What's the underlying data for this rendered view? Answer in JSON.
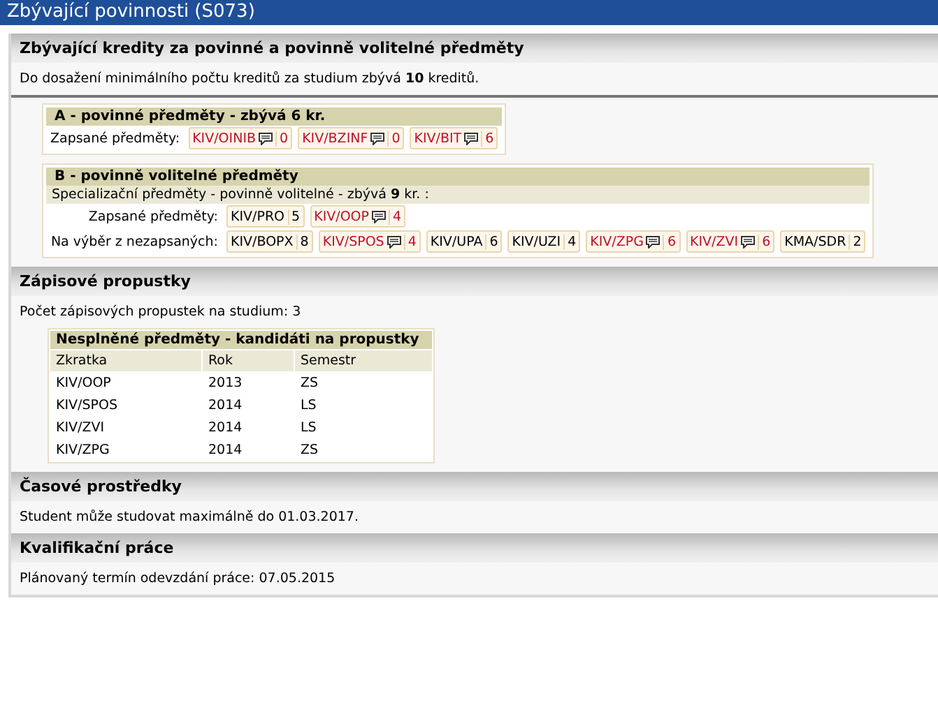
{
  "window": {
    "title": "Zbývající povinnosti (S073)"
  },
  "credits": {
    "title": "Zbývající kredity za povinné a povinně volitelné předměty",
    "summary": "Do dosažení minimálního počtu kreditů za studium zbývá **10** kreditů.",
    "groups": [
      {
        "title": "A - povinné předměty - zbývá 6 kr.",
        "rows": [
          {
            "label": "Zapsané předměty:",
            "courses": [
              {
                "code": "KIV/OINIB",
                "credits": "0",
                "flagged": true
              },
              {
                "code": "KIV/BZINF",
                "credits": "0",
                "flagged": true
              },
              {
                "code": "KIV/BIT",
                "credits": "6",
                "flagged": true
              }
            ]
          }
        ]
      },
      {
        "title": "B - povinně volitelné předměty",
        "subtitle": "Specializační předměty - povinně volitelné - zbývá **9** kr. :",
        "rows": [
          {
            "label": "Zapsané předměty:",
            "courses": [
              {
                "code": "KIV/PRO",
                "credits": "5",
                "flagged": false
              },
              {
                "code": "KIV/OOP",
                "credits": "4",
                "flagged": true
              }
            ]
          },
          {
            "label": "Na výběr z nezapsaných:",
            "courses": [
              {
                "code": "KIV/BOPX",
                "credits": "8",
                "flagged": false
              },
              {
                "code": "KIV/SPOS",
                "credits": "4",
                "flagged": true
              },
              {
                "code": "KIV/UPA",
                "credits": "6",
                "flagged": false
              },
              {
                "code": "KIV/UZI",
                "credits": "4",
                "flagged": false
              },
              {
                "code": "KIV/ZPG",
                "credits": "6",
                "flagged": true
              },
              {
                "code": "KIV/ZVI",
                "credits": "6",
                "flagged": true
              },
              {
                "code": "KMA/SDR",
                "credits": "2",
                "flagged": false
              }
            ]
          }
        ]
      }
    ]
  },
  "passes": {
    "title": "Zápisové propustky",
    "summary": "Počet zápisových propustek na studium: 3",
    "table": {
      "title": "Nesplněné předměty - kandidáti na propustky",
      "columns": [
        "Zkratka",
        "Rok",
        "Semestr"
      ],
      "rows": [
        [
          "KIV/OOP",
          "2013",
          "ZS"
        ],
        [
          "KIV/SPOS",
          "2014",
          "LS"
        ],
        [
          "KIV/ZVI",
          "2014",
          "LS"
        ],
        [
          "KIV/ZPG",
          "2014",
          "ZS"
        ]
      ]
    }
  },
  "time": {
    "title": "Časové prostředky",
    "text": "Student může studovat maximálně do 01.03.2017."
  },
  "thesis": {
    "title": "Kvalifikační práce",
    "text": "Plánovaný termín odevzdání práce: 07.05.2015"
  }
}
